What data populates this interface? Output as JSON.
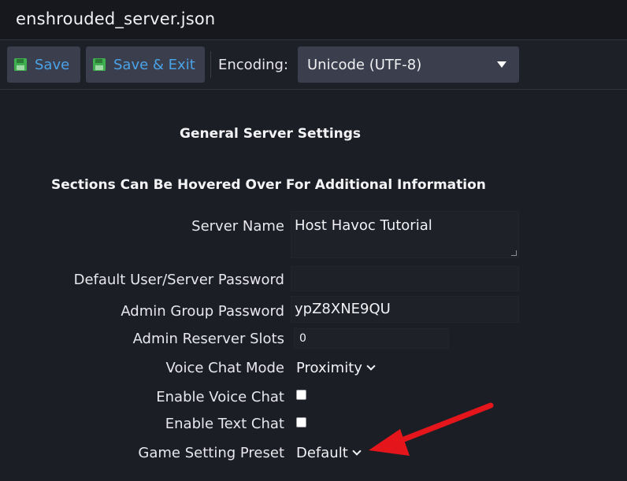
{
  "window": {
    "title": "enshrouded_server.json"
  },
  "toolbar": {
    "save_label": "Save",
    "save_exit_label": "Save & Exit",
    "encoding_label": "Encoding:",
    "encoding_value": "Unicode (UTF-8)"
  },
  "headings": {
    "general": "General Server Settings",
    "hover_hint": "Sections Can Be Hovered Over For Additional Information"
  },
  "settings": {
    "server_name": {
      "label": "Server Name",
      "value": "Host Havoc Tutorial"
    },
    "default_password": {
      "label": "Default User/Server Password",
      "value": ""
    },
    "admin_password": {
      "label": "Admin Group Password",
      "value": "ypZ8XNE9QU"
    },
    "admin_reserver_slots": {
      "label": "Admin Reserver Slots",
      "value": "0"
    },
    "voice_chat_mode": {
      "label": "Voice Chat Mode",
      "value": "Proximity"
    },
    "enable_voice_chat": {
      "label": "Enable Voice Chat",
      "checked": false
    },
    "enable_text_chat": {
      "label": "Enable Text Chat",
      "checked": false
    },
    "game_setting_preset": {
      "label": "Game Setting Preset",
      "value": "Default"
    }
  },
  "colors": {
    "accent": "#4aa3e8",
    "save_icon": "#3fae4f",
    "annotation_arrow": "#e5161b"
  },
  "icons": {
    "save": "floppy-disk-icon",
    "save_exit": "floppy-disk-icon",
    "encoding_caret": "caret-down-icon",
    "dropdown_chevron": "chevron-down-icon"
  }
}
